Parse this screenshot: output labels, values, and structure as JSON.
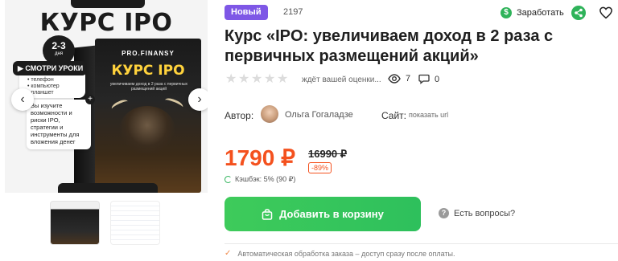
{
  "gallery": {
    "cover": {
      "title": "КУРС IPO",
      "duration_value": "2-3",
      "duration_unit": "дня",
      "lessons_heading": "СМОТРИ УРОКИ",
      "devices": [
        "телефон",
        "компьютер",
        "планшет"
      ],
      "description": "Вы изучите возможности и риски IPO, стратегии и инструменты для вложения денег",
      "box_brand": "PRO.FINANSY",
      "box_title": "КУРС IPO",
      "box_subtitle": "увеличиваем доход в 2 раза с первичных размещений акций"
    },
    "prev_arrow": "‹",
    "next_arrow": "›"
  },
  "header": {
    "badge": "Новый",
    "product_id": "2197",
    "cashback_link": "Заработать"
  },
  "title": "Курс «IPO: увеличиваем доход в 2 раза с первичных размещений акций»",
  "rating": {
    "stars": 5,
    "filled": 0,
    "text": "ждёт вашей оценки...",
    "views": "7",
    "comments": "0"
  },
  "author": {
    "label": "Автор:",
    "name": "Ольга Гогаладзе"
  },
  "site": {
    "label": "Сайт:",
    "link": "показать url"
  },
  "pricing": {
    "price": "1790 ₽",
    "old_price": "16990 ₽",
    "discount": "-89%",
    "cashback": "Кэшбэк: 5% (90 ₽)"
  },
  "actions": {
    "add_to_cart": "Добавить в корзину",
    "questions": "Есть вопросы?"
  },
  "footnote": "Автоматическая обработка заказа – доступ сразу после оплаты.",
  "colors": {
    "badge": "#7e57e6",
    "price": "#f4511e",
    "cart_button": "#35c45b",
    "cashback_icon": "#2fb35a"
  },
  "icons": [
    "dollar-icon",
    "share-icon",
    "heart-icon",
    "eye-icon",
    "comment-icon",
    "bag-icon",
    "question-icon",
    "check-icon"
  ]
}
